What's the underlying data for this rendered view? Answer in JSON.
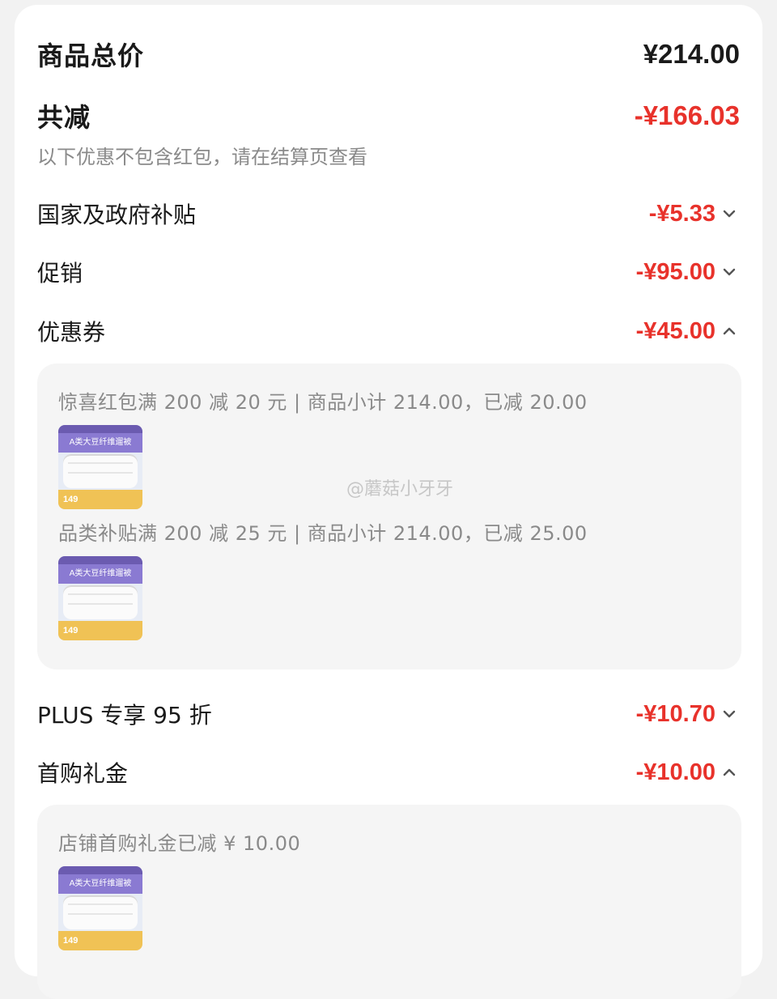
{
  "summary": {
    "total_label": "商品总价",
    "total_value": "¥214.00",
    "reduction_label": "共减",
    "reduction_value": "-¥166.03",
    "note": "以下优惠不包含红包，请在结算页查看"
  },
  "discounts": [
    {
      "label": "国家及政府补贴",
      "value": "-¥5.33",
      "expanded": false
    },
    {
      "label": "促销",
      "value": "-¥95.00",
      "expanded": false
    },
    {
      "label": "优惠券",
      "value": "-¥45.00",
      "expanded": true
    },
    {
      "label": "PLUS 专享 95 折",
      "value": "-¥10.70",
      "expanded": false
    },
    {
      "label": "首购礼金",
      "value": "-¥10.00",
      "expanded": true
    }
  ],
  "coupon_panel": {
    "items": [
      {
        "text": "惊喜红包满 200 减 20 元 | 商品小计 214.00，已减 20.00"
      },
      {
        "text": "品类补贴满 200 减 25 元 | 商品小计 214.00，已减 25.00"
      }
    ]
  },
  "first_purchase_panel": {
    "items": [
      {
        "text": "店铺首购礼金已减 ¥ 10.00"
      }
    ]
  },
  "thumbnail": {
    "headline": "A类大豆纤维遛被",
    "price": "149"
  },
  "watermark": "@蘑菇小牙牙",
  "colors": {
    "accent_red": "#e8322b",
    "muted_text": "#8a8a8a",
    "panel_bg": "#f5f5f5"
  }
}
